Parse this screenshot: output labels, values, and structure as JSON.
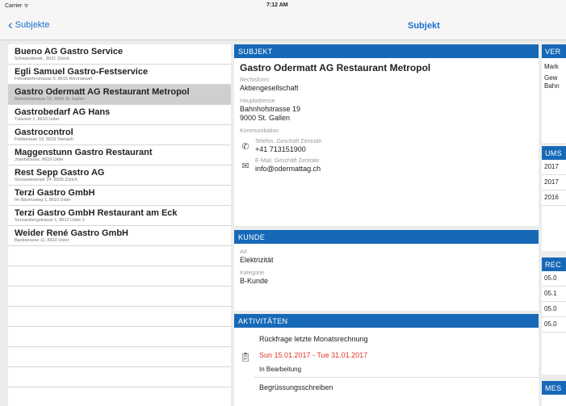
{
  "status": {
    "carrier": "Carrier ᯤ",
    "time": "7:12 AM"
  },
  "nav": {
    "back_label": "Subjekte",
    "title": "Subjekt"
  },
  "list": [
    {
      "name": "Bueno AG Gastro Service",
      "addr": "Schwandenstr., 8031 Zürich"
    },
    {
      "name": "Egli Samuel Gastro-Festservice",
      "addr": "Fehraltorferstrasse 5, 8615 Wermatswil"
    },
    {
      "name": "Gastro Odermatt AG Restaurant Metropol",
      "addr": "Bahnhofstrasse 19, 9000 St. Gallen"
    },
    {
      "name": "Gastrobedarf AG Hans",
      "addr": "Tulacker 1, 8610 Uster"
    },
    {
      "name": "Gastrocontrol",
      "addr": "Feldstrasse 19, 5023 Stenach"
    },
    {
      "name": "Maggenstunn Gastro Restaurant",
      "addr": "Josefstrasse, 8610 Uster"
    },
    {
      "name": "Rest Sepp Gastro AG",
      "addr": "Grosswiesenstr 24, 8005 Zürich"
    },
    {
      "name": "Terzi Gastro GmbH",
      "addr": "Im Bärenzweg 1, 8610 Uster"
    },
    {
      "name": "Terzi Gastro GmbH Restaurant am Eck",
      "addr": "Sonnenbergstrasse 1, 8612 Uster 2"
    },
    {
      "name": "Weider René Gastro GmbH",
      "addr": "Bankstrasse 11, 8610 Uster"
    }
  ],
  "subjekt": {
    "header": "SUBJEKT",
    "title": "Gastro Odermatt AG Restaurant Metropol",
    "rechtsform_label": "Rechtsform",
    "rechtsform": "Aktiengesellschaft",
    "adresse_label": "Hauptadresse",
    "adresse_line1": "Bahnhofstrasse 19",
    "adresse_line2": "9000 St. Gallen",
    "kommunikation_label": "Kommunikation",
    "phone_label": "Telefon, Geschäft Zentrale",
    "phone": "+41 713151900",
    "email_label": "E-Mail, Geschäft Zentrale",
    "email": "info@odermattag.ch"
  },
  "kunde": {
    "header": "KUNDE",
    "art_label": "Art",
    "art": "Elektrizität",
    "kategorie_label": "Kategorie",
    "kategorie": "B-Kunde"
  },
  "aktivitaeten": {
    "header": "AKTIVITÄTEN",
    "items": [
      {
        "title": "Rückfrage letzte Monatsrechnung",
        "date": "Sun 15.01.2017 - Tue 31.01.2017",
        "status": "In Bearbeitung"
      },
      {
        "title": "Begrüssungsschreiben"
      }
    ]
  },
  "right": {
    "head1": "VER",
    "t1": "Mark",
    "t2": "Gew",
    "t3": "Bahn",
    "head2": "UMS",
    "u1": "2017",
    "u2": "2017",
    "u3": "2016",
    "head3": "REC",
    "r1": "05.0",
    "r2": "05.1",
    "r3": "05.0",
    "r4": "05.0",
    "head4": "MES"
  },
  "colors": {
    "accent": "#1769b8",
    "nav_tint": "#1a6fcf",
    "date_red": "#e0332b"
  }
}
